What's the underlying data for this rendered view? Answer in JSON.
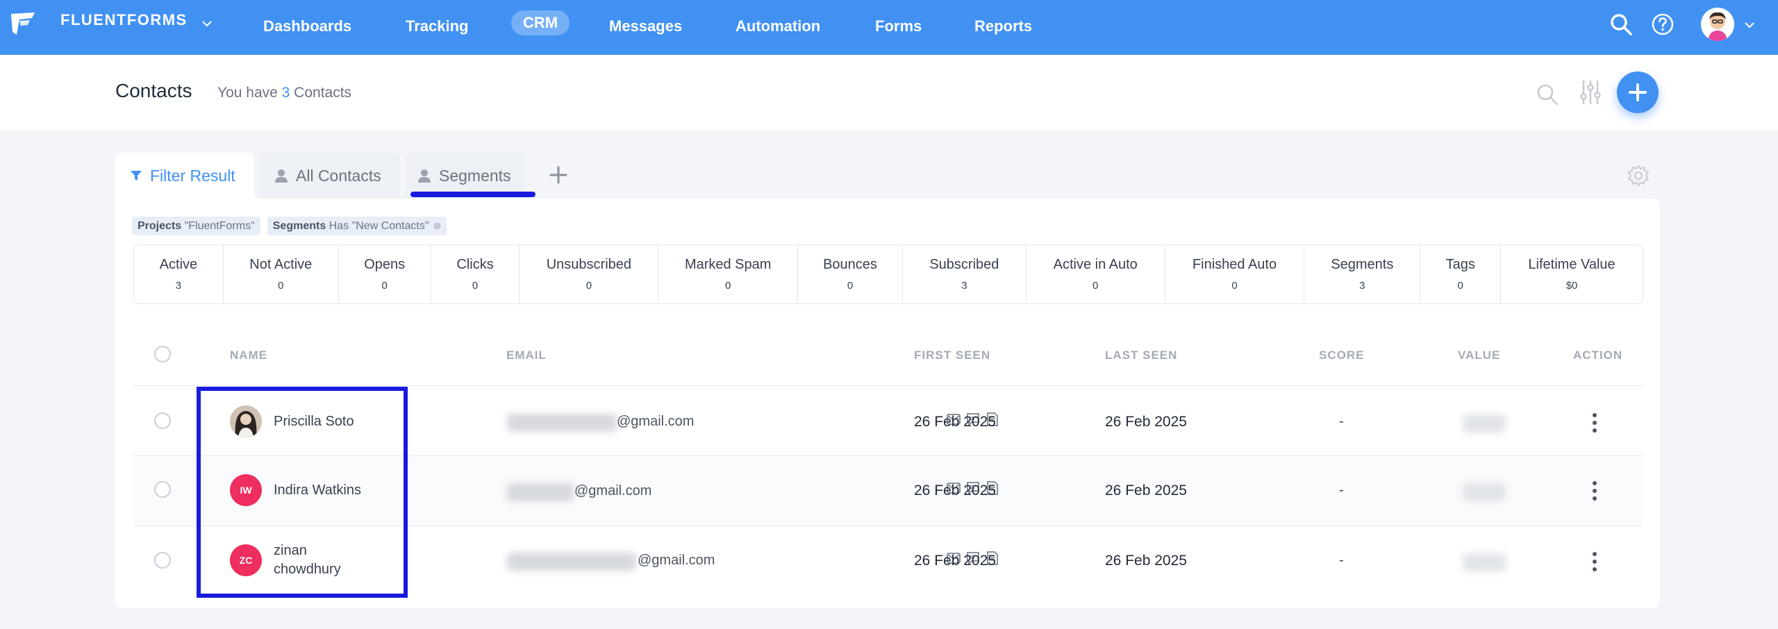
{
  "nav": {
    "brand": "FLUENTFORMS",
    "items": [
      "Dashboards",
      "Tracking",
      "CRM",
      "Messages",
      "Automation",
      "Forms",
      "Reports"
    ],
    "active": "CRM"
  },
  "header": {
    "title": "Contacts",
    "subtitle_prefix": "You have ",
    "count": "3",
    "subtitle_suffix": " Contacts"
  },
  "tabs": {
    "filter": "Filter Result",
    "all": "All Contacts",
    "segments": "Segments"
  },
  "filters": [
    {
      "key": "Projects",
      "value": "\"FluentForms\""
    },
    {
      "key": "Segments",
      "value": "Has \"New Contacts\""
    }
  ],
  "stats": [
    {
      "label": "Active",
      "value": "3"
    },
    {
      "label": "Not Active",
      "value": "0"
    },
    {
      "label": "Opens",
      "value": "0"
    },
    {
      "label": "Clicks",
      "value": "0"
    },
    {
      "label": "Unsubscribed",
      "value": "0"
    },
    {
      "label": "Marked Spam",
      "value": "0"
    },
    {
      "label": "Bounces",
      "value": "0"
    },
    {
      "label": "Subscribed",
      "value": "3"
    },
    {
      "label": "Active in Auto",
      "value": "0"
    },
    {
      "label": "Finished Auto",
      "value": "0"
    },
    {
      "label": "Segments",
      "value": "3"
    },
    {
      "label": "Tags",
      "value": "0"
    },
    {
      "label": "Lifetime Value",
      "value": "$0"
    }
  ],
  "table": {
    "columns": [
      "NAME",
      "EMAIL",
      "FIRST SEEN",
      "LAST SEEN",
      "SCORE",
      "VALUE",
      "ACTION"
    ],
    "rows": [
      {
        "name": "Priscilla Soto",
        "initials": "",
        "email_domain": "@gmail.com",
        "first_seen": "26 Feb 2025",
        "last_seen": "26 Feb 2025",
        "score": "-"
      },
      {
        "name": "Indira Watkins",
        "initials": "IW",
        "email_domain": "@gmail.com",
        "first_seen": "26 Feb 2025",
        "last_seen": "26 Feb 2025",
        "score": "-"
      },
      {
        "name": "zinan chowdhury",
        "initials": "ZC",
        "email_domain": "@gmail.com",
        "first_seen": "26 Feb 2025",
        "last_seen": "26 Feb 2025",
        "score": "-"
      }
    ]
  },
  "colors": {
    "primary": "#4191f3",
    "highlight": "#1a1adf",
    "avatar_pink": "#ee2e5e"
  },
  "icons": [
    "logo-icon",
    "chevron-down-icon",
    "search-icon",
    "help-icon",
    "sliders-icon",
    "plus-icon",
    "filter-icon",
    "user-icon",
    "gear-icon",
    "mail-icon",
    "message-icon",
    "document-icon",
    "more-vertical-icon"
  ]
}
